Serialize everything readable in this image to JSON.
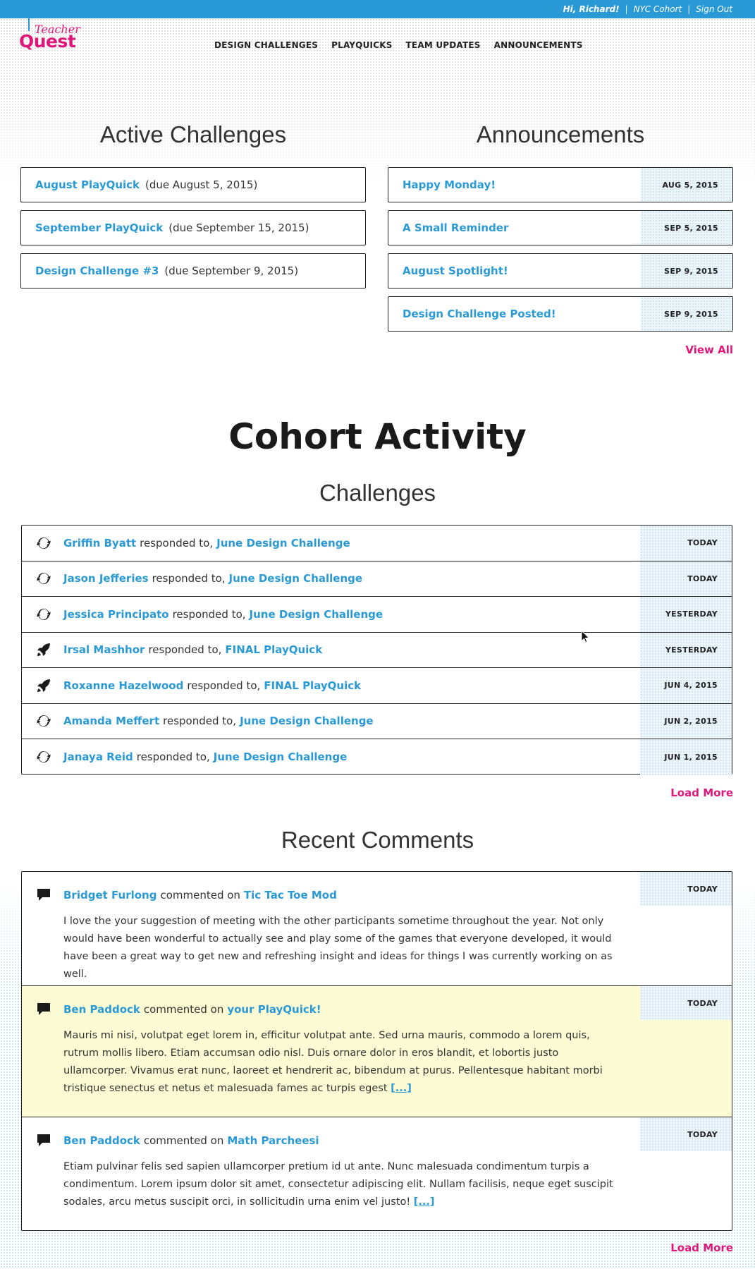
{
  "topbar": {
    "greeting": "Hi, Richard!",
    "cohort": "NYC Cohort",
    "signout": "Sign Out"
  },
  "logo": {
    "line1": "Teacher",
    "line2": "Quest"
  },
  "nav": [
    "DESIGN CHALLENGES",
    "PLAYQUICKS",
    "TEAM UPDATES",
    "ANNOUNCEMENTS"
  ],
  "active_challenges": {
    "title": "Active Challenges",
    "items": [
      {
        "name": "August PlayQuick",
        "due": "(due August 5, 2015)"
      },
      {
        "name": "September PlayQuick",
        "due": "(due September 15, 2015)"
      },
      {
        "name": "Design Challenge #3",
        "due": "(due September 9, 2015)"
      }
    ]
  },
  "announcements": {
    "title": "Announcements",
    "items": [
      {
        "name": "Happy Monday!",
        "date": "AUG 5, 2015"
      },
      {
        "name": "A Small Reminder",
        "date": "SEP 5, 2015"
      },
      {
        "name": "August Spotlight!",
        "date": "SEP 9, 2015"
      },
      {
        "name": "Design Challenge Posted!",
        "date": "SEP 9, 2015"
      }
    ],
    "view_all": "View All"
  },
  "cohort": {
    "title": "Cohort Activity",
    "challenges_title": "Challenges",
    "verb": "responded to,",
    "rows": [
      {
        "icon": "refresh-icon",
        "person": "Griffin Byatt",
        "target": "June Design Challenge",
        "date": "TODAY"
      },
      {
        "icon": "refresh-icon",
        "person": "Jason Jefferies",
        "target": "June Design Challenge",
        "date": "TODAY"
      },
      {
        "icon": "refresh-icon",
        "person": "Jessica Principato",
        "target": "June Design Challenge",
        "date": "YESTERDAY"
      },
      {
        "icon": "rocket-icon",
        "person": "Irsal Mashhor",
        "target": "FINAL PlayQuick",
        "date": "YESTERDAY"
      },
      {
        "icon": "rocket-icon",
        "person": "Roxanne Hazelwood",
        "target": "FINAL PlayQuick",
        "date": "JUN 4, 2015"
      },
      {
        "icon": "refresh-icon",
        "person": "Amanda Meffert",
        "target": "June Design Challenge",
        "date": "JUN 2, 2015"
      },
      {
        "icon": "refresh-icon",
        "person": "Janaya Reid",
        "target": "June Design Challenge",
        "date": "JUN 1, 2015"
      }
    ],
    "load_more": "Load More"
  },
  "comments": {
    "title": "Recent Comments",
    "verb": "commented on",
    "rows": [
      {
        "icon": "comment-icon",
        "person": "Bridget Furlong",
        "target": "Tic Tac Toe Mod",
        "date": "TODAY",
        "body": "I love the your suggestion of meeting with the other participants sometime throughout the year. Not only would have been wonderful to actually see and play some of the games that everyone developed, it would have been a great way to get new and refreshing insight and ideas for things I was currently working on as well.",
        "more": ""
      },
      {
        "icon": "comment-icon",
        "person": "Ben Paddock",
        "target": "your PlayQuick!",
        "date": "TODAY",
        "body": "Mauris mi nisi, volutpat eget lorem in, efficitur volutpat ante. Sed urna mauris, commodo a lorem quis, rutrum mollis libero. Etiam accumsan odio nisl. Duis ornare dolor in eros blandit, et lobortis justo ullamcorper. Vivamus erat nunc, laoreet et hendrerit ac, bibendum at purus. Pellentesque habitant morbi tristique senectus et netus et malesuada fames ac turpis egest",
        "more": "[...]"
      },
      {
        "icon": "comment-icon",
        "person": "Ben Paddock",
        "target": "Math Parcheesi",
        "date": "TODAY",
        "body": "Etiam pulvinar felis sed sapien ullamcorper pretium id ut ante. Nunc malesuada condimentum turpis a condimentum. Lorem ipsum dolor sit amet, consectetur adipiscing elit. Nullam facilisis, neque eget suscipit sodales, arcu metus suscipit orci, in sollicitudin urna enim vel justo!",
        "more": "[...]"
      }
    ],
    "load_more": "Load More"
  },
  "colors": {
    "accent_blue": "#2a9ad6",
    "accent_pink": "#e0177a",
    "highlight": "#fdfbd3"
  }
}
